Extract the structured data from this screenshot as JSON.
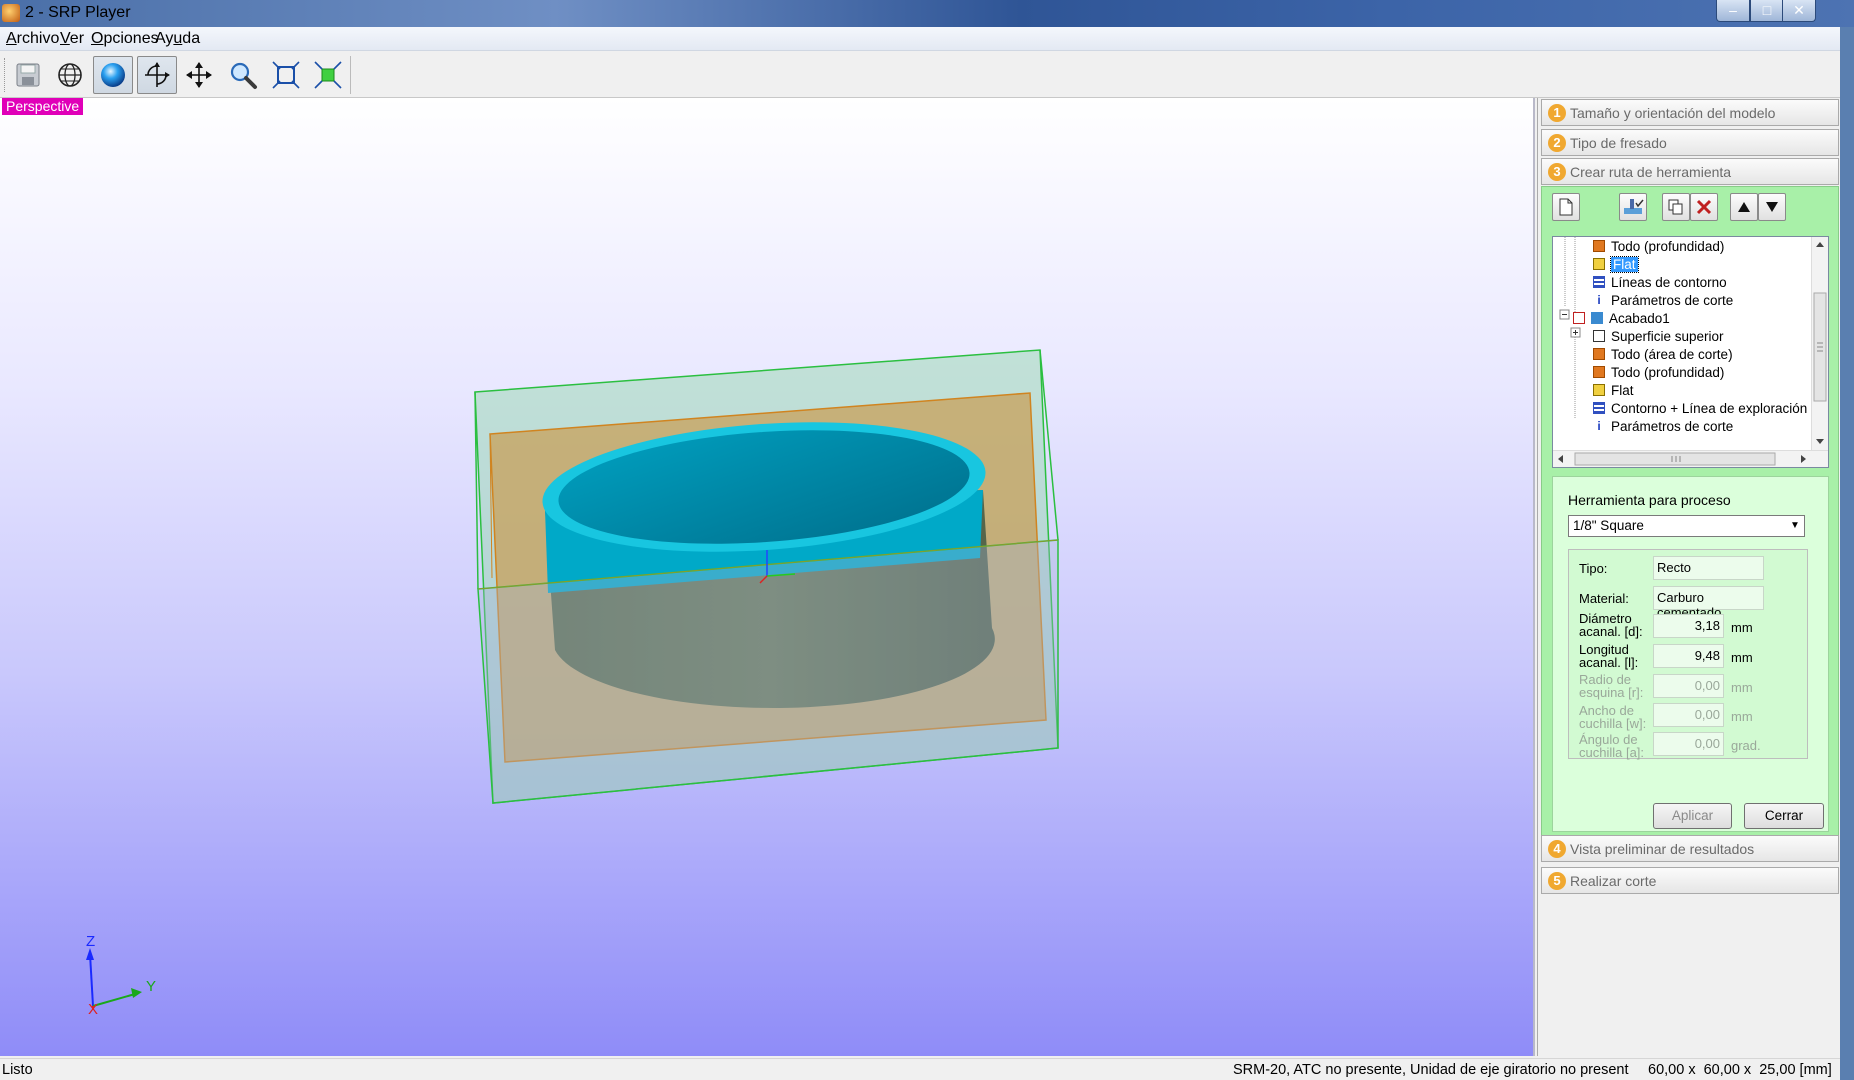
{
  "window": {
    "title": "2 - SRP Player",
    "min": "–",
    "max": "□",
    "close": "✕"
  },
  "menu": [
    {
      "label": "Archivo",
      "u": "A",
      "rest": "rchivo"
    },
    {
      "label": "Ver",
      "u": "V",
      "rest": "er"
    },
    {
      "label": "Opciones",
      "u": "O",
      "rest": "pciones"
    },
    {
      "label": "Ayuda",
      "pre": "Ay",
      "u": "u",
      "rest": "da"
    }
  ],
  "toolbar": {
    "icons": [
      "save-icon",
      "wireframe-globe-icon",
      "shaded-sphere-icon",
      "rotate-icon",
      "pan-icon",
      "zoom-icon",
      "fit-all-icon",
      "fit-selection-icon"
    ],
    "pressed": [
      "shaded-sphere-icon",
      "rotate-icon"
    ]
  },
  "viewport": {
    "view_label": "Perspective",
    "axes": {
      "x": "X",
      "y": "Y",
      "z": "Z"
    }
  },
  "panel": {
    "steps": [
      {
        "num": "1",
        "label": "Tamaño y orientación del modelo"
      },
      {
        "num": "2",
        "label": "Tipo de fresado"
      },
      {
        "num": "3",
        "label": "Crear ruta de herramienta"
      },
      {
        "num": "4",
        "label": "Vista preliminar de resultados"
      },
      {
        "num": "5",
        "label": "Realizar corte"
      }
    ],
    "tree": [
      {
        "label": "Todo (profundidad)",
        "icon": "orange-square-icon"
      },
      {
        "label": "Flat",
        "icon": "yellow-tool-icon",
        "selected": true
      },
      {
        "label": "Líneas de contorno",
        "icon": "blue-lines-icon"
      },
      {
        "label": "Parámetros de corte",
        "icon": "info-icon"
      },
      {
        "label": "Acabado1",
        "icon": "finish-icon"
      },
      {
        "label": "Superficie superior",
        "icon": "surface-icon"
      },
      {
        "label": "Todo (área de corte)",
        "icon": "orange-square-icon"
      },
      {
        "label": "Todo (profundidad)",
        "icon": "orange-square-icon"
      },
      {
        "label": "Flat",
        "icon": "yellow-tool-icon"
      },
      {
        "label": "Contorno + Línea de exploración",
        "icon": "blue-lines-icon"
      },
      {
        "label": "Parámetros de corte",
        "icon": "info-icon"
      }
    ],
    "tool": {
      "header": "Herramienta para proceso",
      "selected": "1/8\" Square",
      "props": [
        {
          "label": "Tipo:",
          "value": "Recto"
        },
        {
          "label": "Material:",
          "value": "Carburo cementado"
        },
        {
          "label": "Diámetro acanal. [d]:",
          "value": "3,18",
          "unit": "mm"
        },
        {
          "label": "Longitud acanal. [l]:",
          "value": "9,48",
          "unit": "mm"
        },
        {
          "label": "Radio de esquina [r]:",
          "value": "0,00",
          "unit": "mm",
          "disabled": true
        },
        {
          "label": "Ancho de cuchilla [w]:",
          "value": "0,00",
          "unit": "mm",
          "disabled": true
        },
        {
          "label": "Ángulo de cuchilla [a]:",
          "value": "0,00",
          "unit": "grad.",
          "disabled": true
        }
      ]
    },
    "buttons": {
      "apply": "Aplicar",
      "close": "Cerrar"
    }
  },
  "status": {
    "left": "Listo",
    "machine": "SRM-20, ATC no presente, Unidad de eje giratorio no present",
    "dims": "60,00 x  60,00 x  25,00 [mm]"
  }
}
